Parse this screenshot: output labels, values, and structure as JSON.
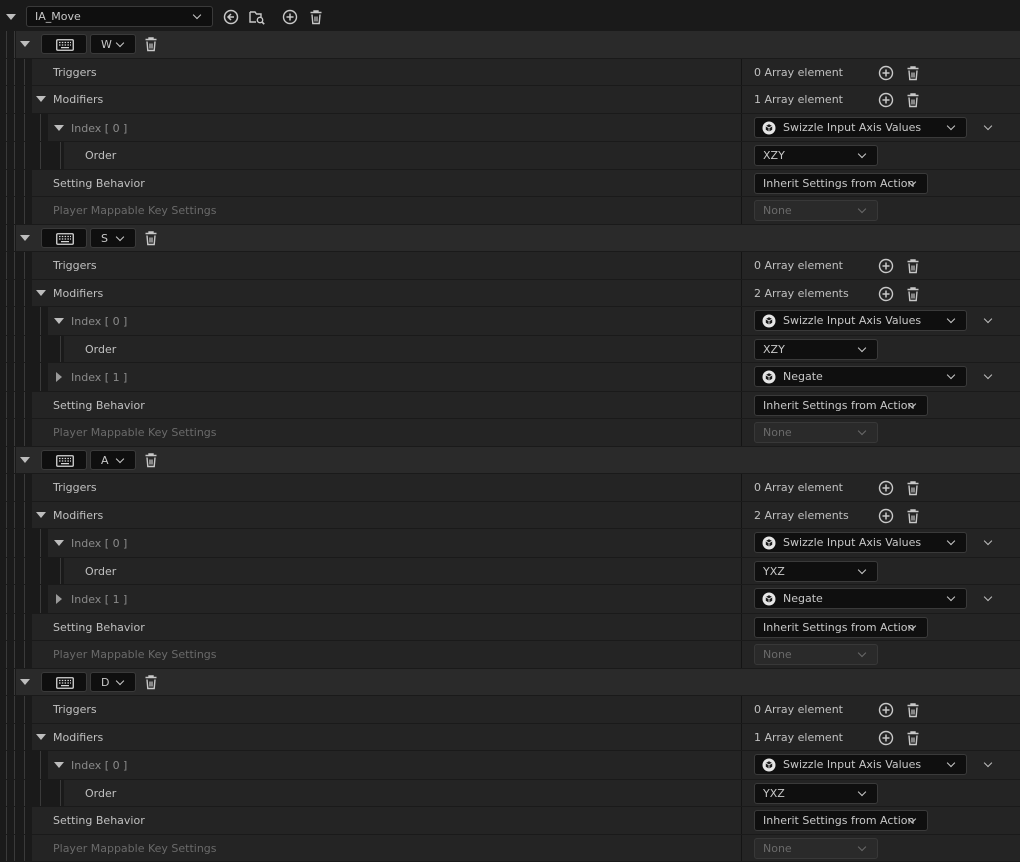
{
  "toolbar": {
    "action_name": "IA_Move",
    "icons": [
      "use-selected-icon",
      "browse-icon",
      "add-icon",
      "delete-icon"
    ]
  },
  "labels": {
    "triggers": "Triggers",
    "modifiers": "Modifiers",
    "order": "Order",
    "setting_behavior": "Setting Behavior",
    "player_mappable": "Player Mappable Key Settings"
  },
  "mappings": [
    {
      "key": "W",
      "triggers_count": "0 Array element",
      "modifiers_count": "1 Array element",
      "modifiers": [
        {
          "index": "Index [ 0 ]",
          "expanded": true,
          "type": "Swizzle Input Axis Values",
          "order": "XZY"
        }
      ],
      "setting_behavior": "Inherit Settings from Action",
      "player_mappable": "None"
    },
    {
      "key": "S",
      "triggers_count": "0 Array element",
      "modifiers_count": "2 Array elements",
      "modifiers": [
        {
          "index": "Index [ 0 ]",
          "expanded": true,
          "type": "Swizzle Input Axis Values",
          "order": "XZY"
        },
        {
          "index": "Index [ 1 ]",
          "expanded": false,
          "type": "Negate"
        }
      ],
      "setting_behavior": "Inherit Settings from Action",
      "player_mappable": "None"
    },
    {
      "key": "A",
      "triggers_count": "0 Array element",
      "modifiers_count": "2 Array elements",
      "modifiers": [
        {
          "index": "Index [ 0 ]",
          "expanded": true,
          "type": "Swizzle Input Axis Values",
          "order": "YXZ"
        },
        {
          "index": "Index [ 1 ]",
          "expanded": false,
          "type": "Negate"
        }
      ],
      "setting_behavior": "Inherit Settings from Action",
      "player_mappable": "None"
    },
    {
      "key": "D",
      "triggers_count": "0 Array element",
      "modifiers_count": "1 Array element",
      "modifiers": [
        {
          "index": "Index [ 0 ]",
          "expanded": true,
          "type": "Swizzle Input Axis Values",
          "order": "YXZ"
        }
      ],
      "setting_behavior": "Inherit Settings from Action",
      "player_mappable": "None"
    }
  ],
  "colors": {
    "background": "#1a1a1a",
    "row": "#242424",
    "header_row": "#2a2a2a",
    "combo": "#0f0f0f",
    "text": "#c0c0c0",
    "text_dim": "#6a6a6a"
  }
}
